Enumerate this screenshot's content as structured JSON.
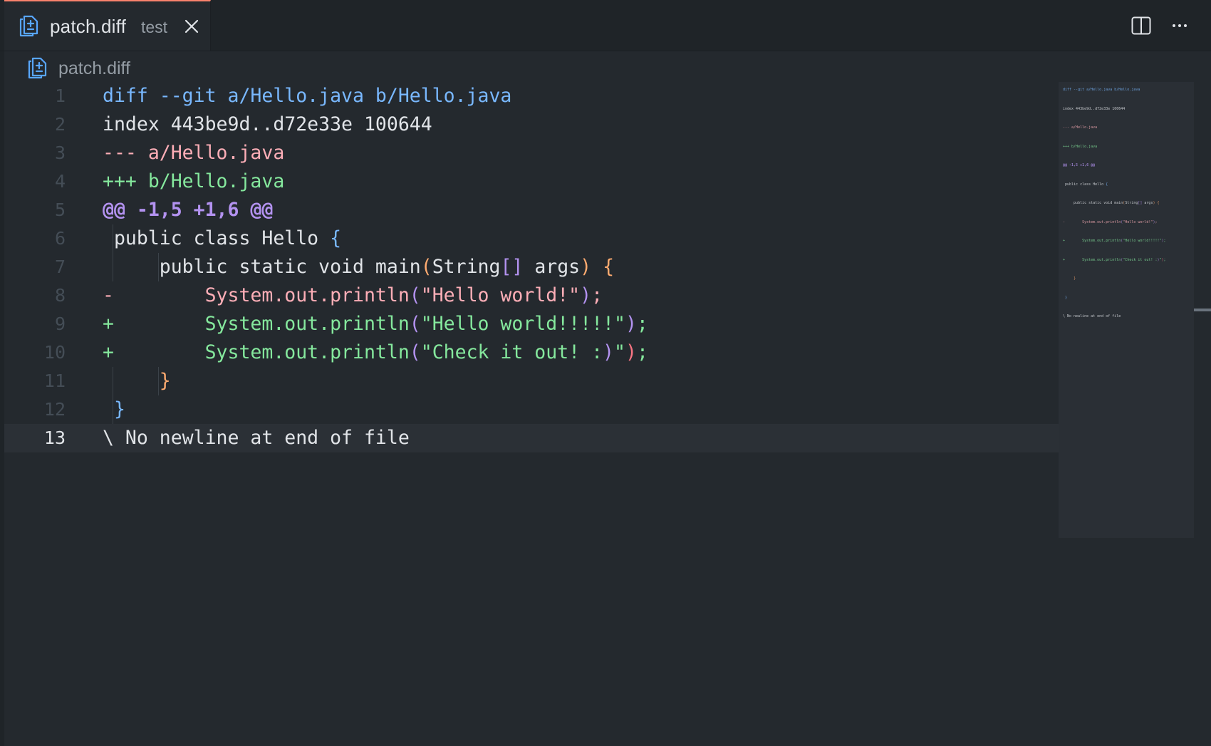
{
  "tab": {
    "title": "patch.diff",
    "description": "test",
    "icon": "diff-file-icon",
    "close_icon": "close-icon",
    "accent_color": "#f9826c"
  },
  "toolbar": {
    "split_icon": "split-editor-icon",
    "more_icon": "more-actions-icon"
  },
  "breadcrumb": {
    "icon": "diff-file-icon",
    "label": "patch.diff"
  },
  "editor": {
    "current_line": 13,
    "lines": [
      {
        "n": "1",
        "tokens": [
          {
            "t": "diff --git a/Hello.java b/Hello.java",
            "c": "c-meta"
          }
        ]
      },
      {
        "n": "2",
        "tokens": [
          {
            "t": "index 443be9d..d72e33e 100644",
            "c": "c-plain"
          }
        ]
      },
      {
        "n": "3",
        "tokens": [
          {
            "t": "--- a/Hello.java",
            "c": "c-del"
          }
        ]
      },
      {
        "n": "4",
        "tokens": [
          {
            "t": "+++ b/Hello.java",
            "c": "c-add"
          }
        ]
      },
      {
        "n": "5",
        "tokens": [
          {
            "t": "@@ -1,5 +1,6 @@",
            "c": "c-hunk"
          }
        ]
      },
      {
        "n": "6",
        "tokens": [
          {
            "t": " public class Hello ",
            "c": "c-plain"
          },
          {
            "t": "{",
            "c": "c-b1"
          }
        ]
      },
      {
        "n": "7",
        "tokens": [
          {
            "t": "     public static void main",
            "c": "c-plain"
          },
          {
            "t": "(",
            "c": "c-b2"
          },
          {
            "t": "String",
            "c": "c-plain"
          },
          {
            "t": "[]",
            "c": "c-b3"
          },
          {
            "t": " args",
            "c": "c-plain"
          },
          {
            "t": ")",
            "c": "c-b2"
          },
          {
            "t": " ",
            "c": "c-plain"
          },
          {
            "t": "{",
            "c": "c-b2"
          }
        ]
      },
      {
        "n": "8",
        "tokens": [
          {
            "t": "-        System.out.println",
            "c": "c-del"
          },
          {
            "t": "(",
            "c": "c-b3"
          },
          {
            "t": "\"Hello world!\"",
            "c": "c-del"
          },
          {
            "t": ")",
            "c": "c-b3"
          },
          {
            "t": ";",
            "c": "c-del"
          }
        ]
      },
      {
        "n": "9",
        "tokens": [
          {
            "t": "+        System.out.println",
            "c": "c-add"
          },
          {
            "t": "(",
            "c": "c-b3"
          },
          {
            "t": "\"Hello world!!!!!\"",
            "c": "c-add"
          },
          {
            "t": ")",
            "c": "c-b3"
          },
          {
            "t": ";",
            "c": "c-add"
          }
        ]
      },
      {
        "n": "10",
        "tokens": [
          {
            "t": "+        System.out.println",
            "c": "c-add"
          },
          {
            "t": "(",
            "c": "c-b3"
          },
          {
            "t": "\"Check it out! :",
            "c": "c-add"
          },
          {
            "t": ")",
            "c": "c-b3"
          },
          {
            "t": "\"",
            "c": "c-add"
          },
          {
            "t": ")",
            "c": "c-red"
          },
          {
            "t": ";",
            "c": "c-add"
          }
        ]
      },
      {
        "n": "11",
        "tokens": [
          {
            "t": "     ",
            "c": "c-plain"
          },
          {
            "t": "}",
            "c": "c-b2"
          }
        ]
      },
      {
        "n": "12",
        "tokens": [
          {
            "t": " ",
            "c": "c-plain"
          },
          {
            "t": "}",
            "c": "c-b1"
          }
        ]
      },
      {
        "n": "13",
        "tokens": [
          {
            "t": "\\ No newline at end of file",
            "c": "c-plain"
          }
        ]
      }
    ]
  }
}
